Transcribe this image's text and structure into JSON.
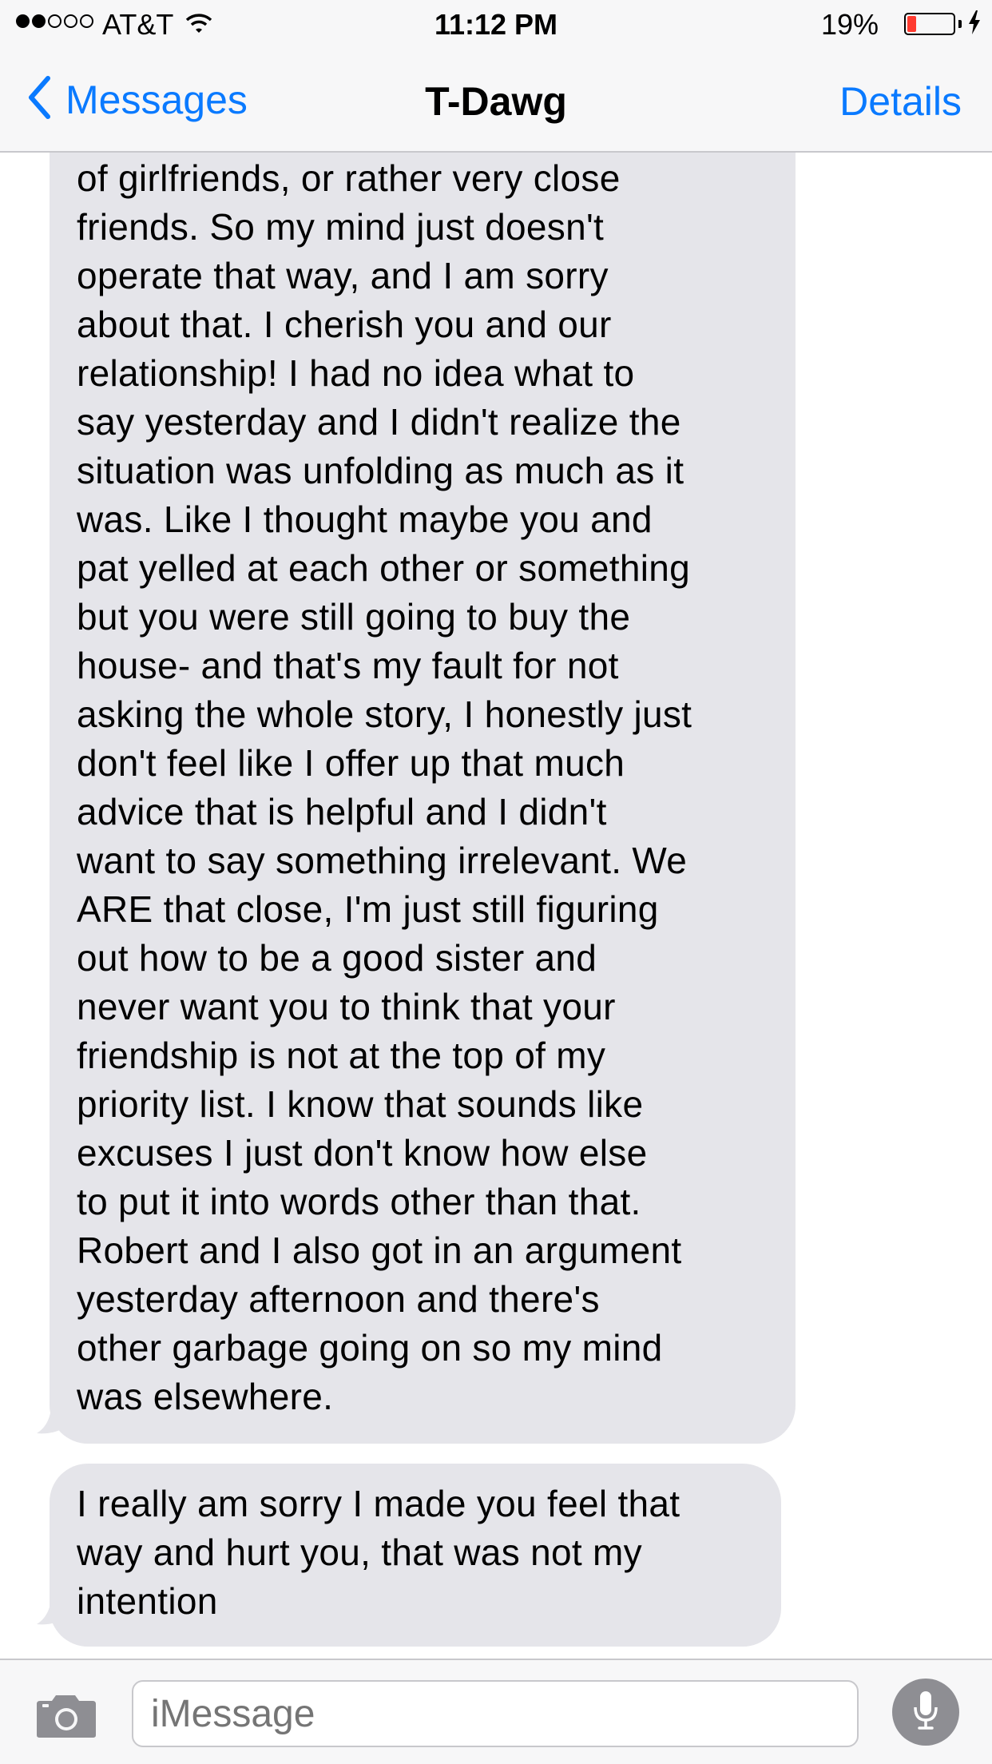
{
  "status_bar": {
    "carrier": "AT&T",
    "time": "11:12 PM",
    "battery_percent": "19%",
    "battery_level": 0.19,
    "signal_bars_filled": 2,
    "signal_bars_total": 5,
    "battery_color": "#ff3b30"
  },
  "nav": {
    "back_label": "Messages",
    "title": "T-Dawg",
    "details_label": "Details",
    "accent_color": "#0a7aff"
  },
  "messages": [
    {
      "direction": "incoming",
      "text": "of girlfriends, or rather very close\nfriends. So my mind just doesn't\noperate that way, and I am sorry\nabout that. I cherish you and our\nrelationship! I had no idea what to\nsay yesterday and I didn't realize the\nsituation was unfolding as much as it\nwas. Like I thought maybe you and\npat yelled at each other or something\nbut you were still going to buy the\nhouse- and that's my fault for not\nasking the whole story, I honestly just\ndon't feel like I offer up that much\nadvice that is helpful and I didn't\nwant to say something irrelevant. We\nARE that close, I'm just still figuring\nout how to be a good sister and\nnever want you to think that your\nfriendship is not at the top of my\npriority list. I know that sounds like\nexcuses I just don't know how else\nto put it into words other than that.\nRobert and I also got in an argument\nyesterday afternoon and there's\nother garbage going on so my mind\nwas elsewhere."
    },
    {
      "direction": "incoming",
      "text": "I really am sorry I made you feel that\nway and hurt you, that was not my\nintention"
    }
  ],
  "bubble_color": "#e5e5ea",
  "input": {
    "placeholder": "iMessage",
    "camera_icon": "camera-icon",
    "mic_icon": "microphone-icon"
  }
}
